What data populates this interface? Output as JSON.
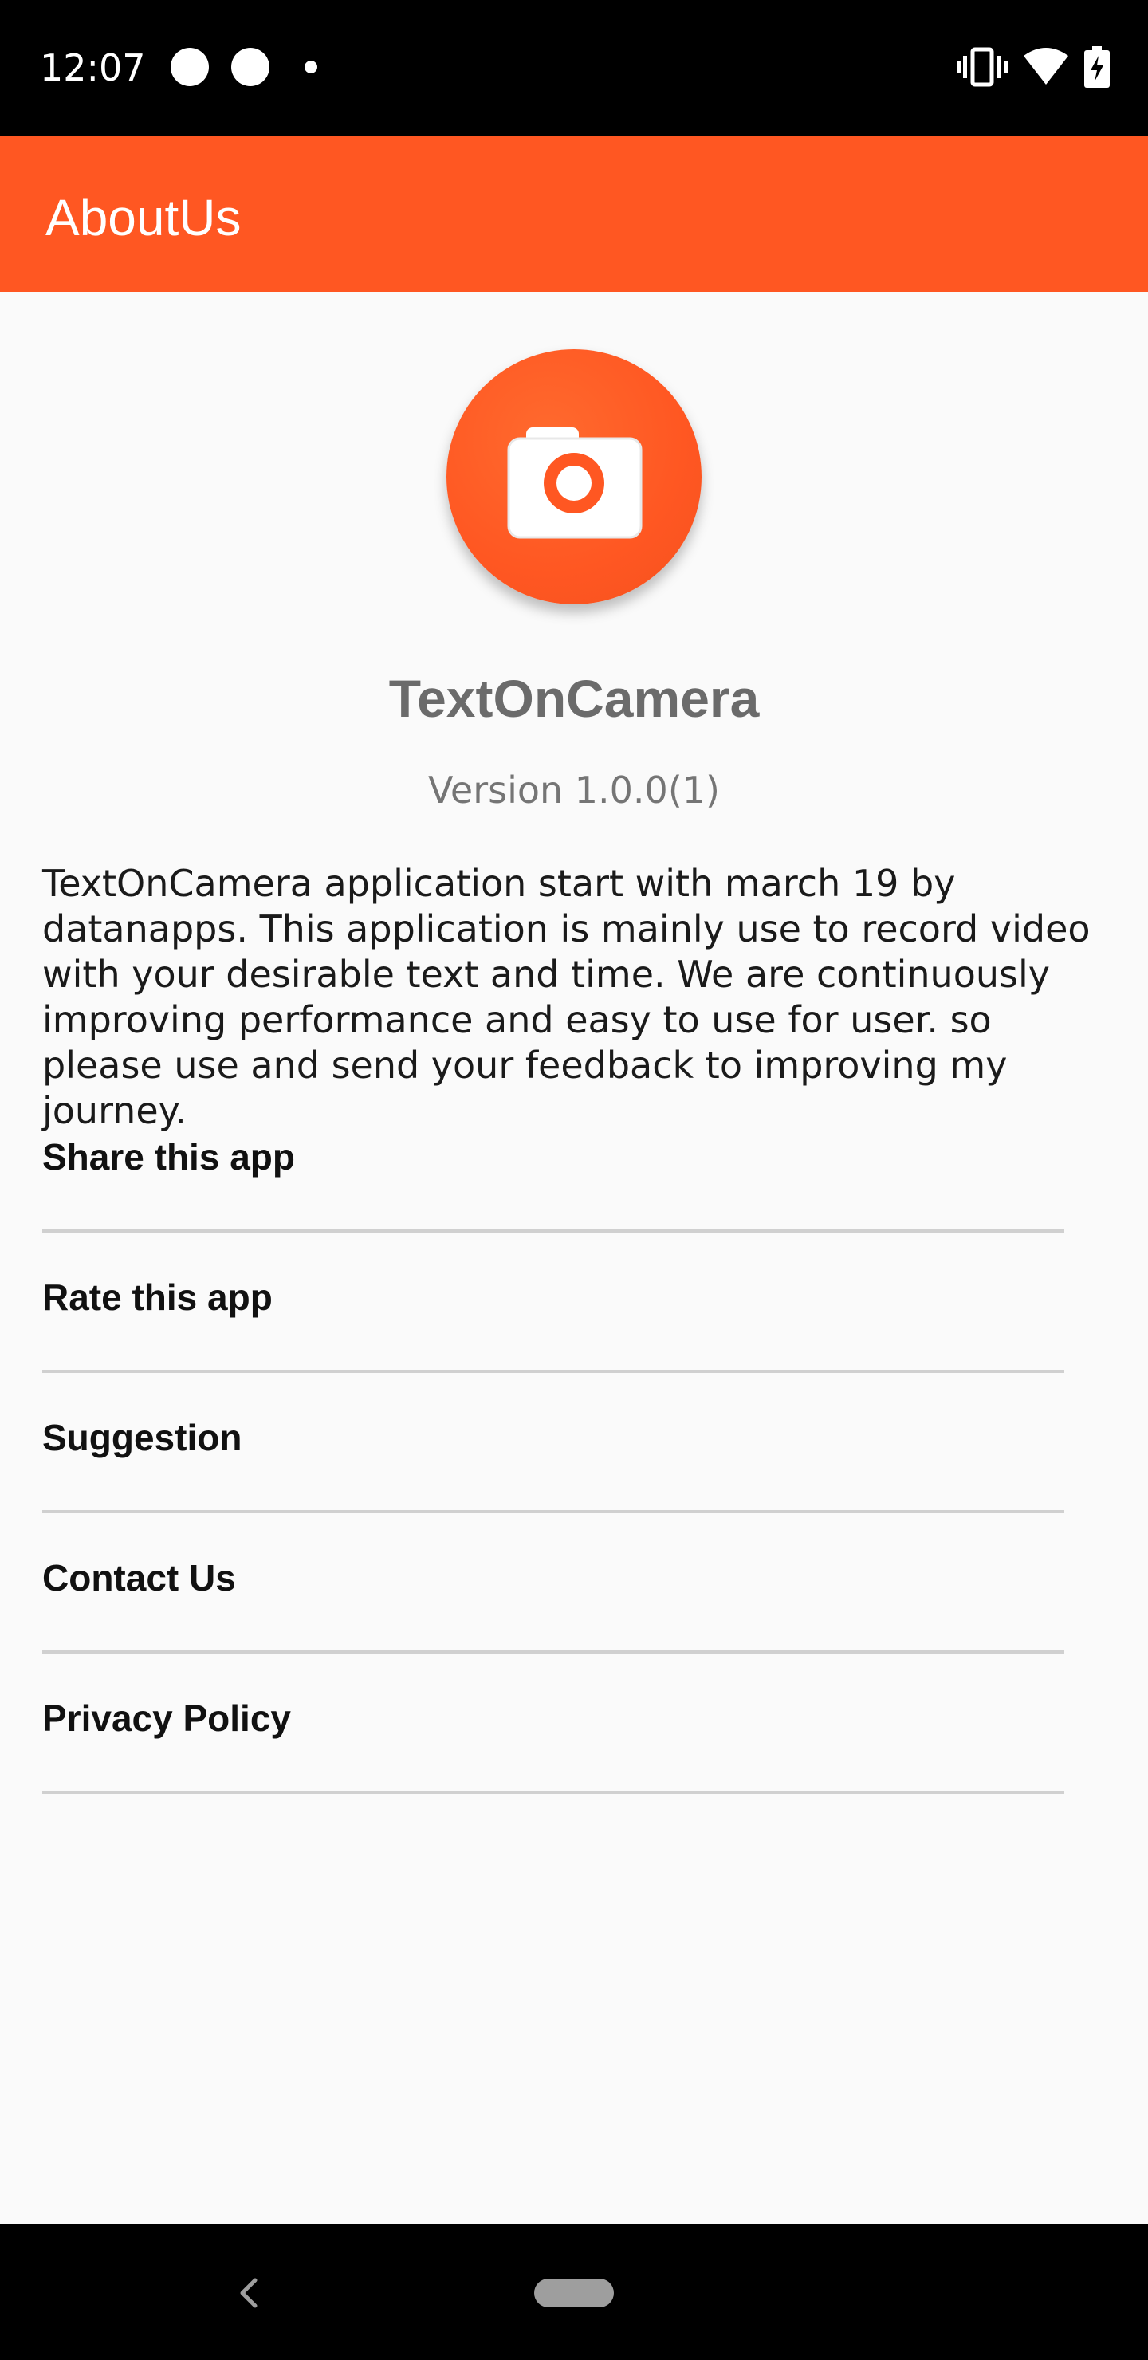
{
  "status_bar": {
    "time": "12:07",
    "icons": [
      "notification-dot-icon",
      "notification-dot-icon",
      "small-dot-icon",
      "vibrate-icon",
      "wifi-icon",
      "battery-charging-icon"
    ]
  },
  "app_bar": {
    "title": "AboutUs",
    "color": "#ff5722"
  },
  "about": {
    "logo_icon": "camera-icon",
    "app_name": "TextOnCamera",
    "version": "Version 1.0.0(1)",
    "description": "TextOnCamera application start with march 19 by datanapps. This application is mainly use to record video with your desirable text and time. We are continuously improving performance and easy to use for user. so please use and send your feedback to improving my journey."
  },
  "menu": {
    "items": [
      {
        "label": "Share this app"
      },
      {
        "label": "Rate this app"
      },
      {
        "label": "Suggestion"
      },
      {
        "label": "Contact Us"
      },
      {
        "label": "Privacy Policy"
      }
    ]
  },
  "nav_bar": {
    "icons": [
      "back-icon",
      "home-pill-icon"
    ]
  }
}
